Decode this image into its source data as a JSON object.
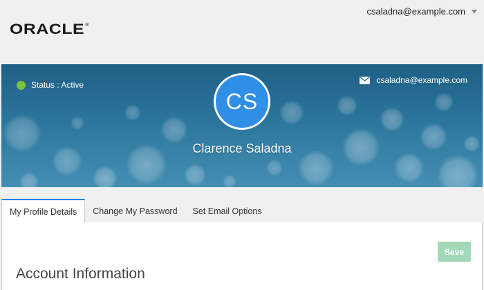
{
  "header": {
    "logo_text": "ORACLE",
    "user_email": "csaladna@example.com"
  },
  "banner": {
    "status_text": "Status : Active",
    "email": "csaladna@example.com",
    "avatar_initials": "CS",
    "user_name": "Clarence Saladna",
    "colors": {
      "status_dot": "#7ac142",
      "avatar": "#2f8ee6"
    }
  },
  "tabs": [
    {
      "label": "My Profile Details",
      "active": true
    },
    {
      "label": "Change My Password",
      "active": false
    },
    {
      "label": "Set Email Options",
      "active": false
    }
  ],
  "main": {
    "save_label": "Save",
    "section_title": "Account Information"
  },
  "icons": [
    "caret-down-icon",
    "status-dot-icon",
    "envelope-icon"
  ]
}
